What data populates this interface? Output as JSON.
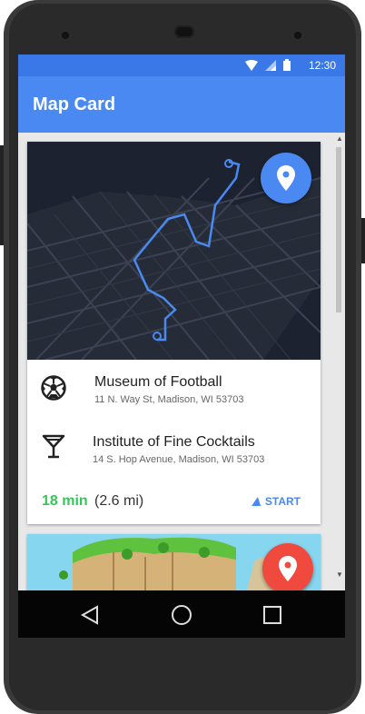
{
  "status_bar": {
    "time": "12:30"
  },
  "app_bar": {
    "title": "Map Card"
  },
  "card": {
    "locations": [
      {
        "name": "Museum of Football",
        "address": "11 N. Way St, Madison, WI 53703",
        "icon": "soccer-ball-icon"
      },
      {
        "name": "Institute of Fine Cocktails",
        "address": "14 S. Hop Avenue, Madison, WI 53703",
        "icon": "cocktail-icon"
      }
    ],
    "travel_time": "18 min",
    "distance": "(2.6 mi)",
    "start_label": "START"
  },
  "colors": {
    "primary": "#4a89f2",
    "status_bar": "#3b78e7",
    "accent_green": "#34c759",
    "fab_red": "#f04a3f"
  }
}
